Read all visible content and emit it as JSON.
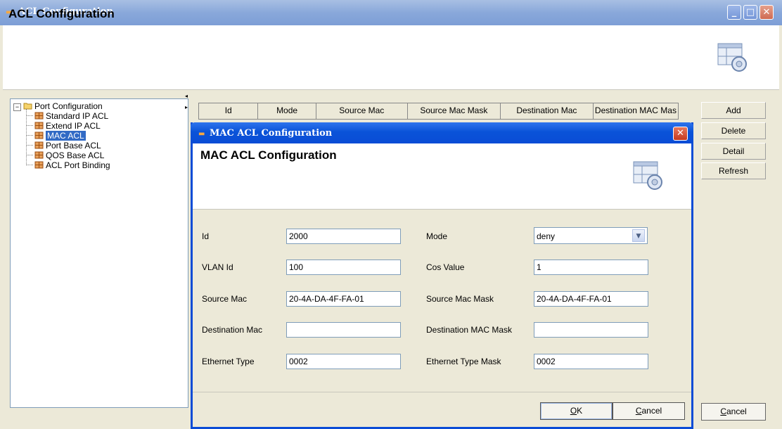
{
  "window": {
    "title": "ACL Configuration",
    "header_title": "ACL Configuration",
    "min_glyph": "_",
    "max_glyph": "□",
    "close_glyph": "✕"
  },
  "tree": {
    "root": "Port Configuration",
    "items": [
      {
        "label": "Standard IP ACL",
        "selected": false
      },
      {
        "label": "Extend IP ACL",
        "selected": false
      },
      {
        "label": "MAC ACL",
        "selected": true
      },
      {
        "label": "Port Base ACL",
        "selected": false
      },
      {
        "label": "QOS Base ACL",
        "selected": false
      },
      {
        "label": "ACL Port Binding",
        "selected": false
      }
    ]
  },
  "table": {
    "columns": [
      "Id",
      "Mode",
      "Source Mac",
      "Source Mac Mask",
      "Destination Mac",
      "Destination MAC Mas"
    ]
  },
  "side_buttons": {
    "add": "Add",
    "delete": "Delete",
    "detail": "Detail",
    "refresh": "Refresh"
  },
  "main_cancel": {
    "underlined": "C",
    "rest": "ancel"
  },
  "dialog": {
    "title": "MAC ACL Configuration",
    "header_title": "MAC ACL Configuration",
    "close_glyph": "✕",
    "fields": {
      "id": {
        "label": "Id",
        "value": "2000"
      },
      "mode": {
        "label": "Mode",
        "value": "deny"
      },
      "vlan_id": {
        "label": "VLAN Id",
        "value": "100"
      },
      "cos_value": {
        "label": "Cos Value",
        "value": "1"
      },
      "source_mac": {
        "label": "Source Mac",
        "value": "20-4A-DA-4F-FA-01"
      },
      "source_mac_mask": {
        "label": "Source Mac Mask",
        "value": "20-4A-DA-4F-FA-01"
      },
      "destination_mac": {
        "label": "Destination Mac",
        "value": ""
      },
      "destination_mac_mask": {
        "label": "Destination MAC Mask",
        "value": ""
      },
      "ethernet_type": {
        "label": "Ethernet Type",
        "value": "0002"
      },
      "ethernet_type_mask": {
        "label": "Ethernet Type Mask",
        "value": "0002"
      }
    },
    "ok": {
      "underlined": "O",
      "rest": "K"
    },
    "cancel": {
      "underlined": "C",
      "rest": "ancel"
    }
  },
  "colors": {
    "title_bar_inactive": "#89a8da",
    "title_bar_active": "#0a4cd6",
    "selection": "#316ac5",
    "face": "#ece9d8"
  }
}
